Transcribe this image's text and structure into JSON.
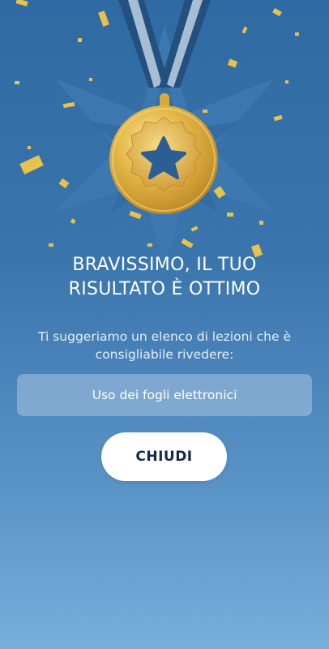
{
  "result": {
    "title_line1": "BRAVISSIMO, IL TUO",
    "title_line2": "RISULTATO È OTTIMO",
    "suggestion_line1": "Ti suggeriamo un elenco di lezioni che è",
    "suggestion_line2": "consigliabile rivedere:"
  },
  "lessons": [
    {
      "label": "Uso dei fogli elettronici"
    }
  ],
  "actions": {
    "close_label": "CHIUDI"
  },
  "decor": {
    "medal_icon": "star-medal-icon",
    "confetti": "gold-confetti",
    "gold": "#d9a93a",
    "ribbon_blue": "#24507f",
    "ribbon_stripe": "#9db6cf"
  }
}
